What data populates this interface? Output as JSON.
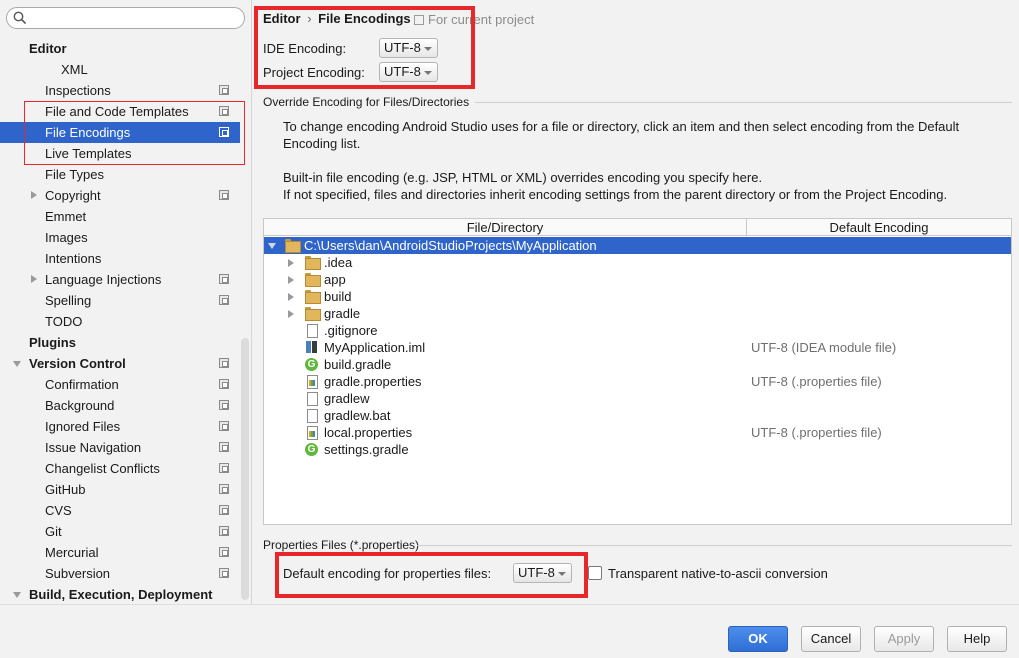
{
  "search": {
    "placeholder": ""
  },
  "sidebar": {
    "items": [
      {
        "label": "Editor",
        "bold": true,
        "indent": "l1"
      },
      {
        "label": "XML",
        "indent": "l3"
      },
      {
        "label": "Inspections",
        "indent": "l2",
        "project": true
      },
      {
        "label": "File and Code Templates",
        "indent": "l2",
        "project": true
      },
      {
        "label": "File Encodings",
        "indent": "l2",
        "project": true,
        "selected": true
      },
      {
        "label": "Live Templates",
        "indent": "l2"
      },
      {
        "label": "File Types",
        "indent": "l2"
      },
      {
        "label": "Copyright",
        "indent": "l2",
        "project": true,
        "expandable": true
      },
      {
        "label": "Emmet",
        "indent": "l2"
      },
      {
        "label": "Images",
        "indent": "l2"
      },
      {
        "label": "Intentions",
        "indent": "l2"
      },
      {
        "label": "Language Injections",
        "indent": "l2",
        "project": true,
        "expandable": true
      },
      {
        "label": "Spelling",
        "indent": "l2",
        "project": true
      },
      {
        "label": "TODO",
        "indent": "l2"
      },
      {
        "label": "Plugins",
        "bold": true,
        "indent": "l1"
      },
      {
        "label": "Version Control",
        "bold": true,
        "indent": "l1",
        "expanded": true,
        "project": true
      },
      {
        "label": "Confirmation",
        "indent": "l2",
        "project": true
      },
      {
        "label": "Background",
        "indent": "l2",
        "project": true
      },
      {
        "label": "Ignored Files",
        "indent": "l2",
        "project": true
      },
      {
        "label": "Issue Navigation",
        "indent": "l2",
        "project": true
      },
      {
        "label": "Changelist Conflicts",
        "indent": "l2",
        "project": true
      },
      {
        "label": "GitHub",
        "indent": "l2",
        "project": true
      },
      {
        "label": "CVS",
        "indent": "l2",
        "project": true
      },
      {
        "label": "Git",
        "indent": "l2",
        "project": true
      },
      {
        "label": "Mercurial",
        "indent": "l2",
        "project": true
      },
      {
        "label": "Subversion",
        "indent": "l2",
        "project": true
      },
      {
        "label": "Build, Execution, Deployment",
        "bold": true,
        "indent": "l1",
        "expanded": true
      }
    ]
  },
  "header": {
    "breadcrumb_parent": "Editor",
    "breadcrumb_sep": "›",
    "breadcrumb_current": "File Encodings",
    "scope_note": "For current project"
  },
  "encoding": {
    "ide_label": "IDE Encoding:",
    "ide_value": "UTF-8",
    "project_label": "Project Encoding:",
    "project_value": "UTF-8"
  },
  "override": {
    "title": "Override Encoding for Files/Directories",
    "desc_line1": "To change encoding Android Studio uses for a file or directory, click an item and then select encoding from the Default",
    "desc_line2": "Encoding list.",
    "desc_line3": "Built-in file encoding (e.g. JSP, HTML or XML) overrides encoding you specify here.",
    "desc_line4": "If not specified, files and directories inherit encoding settings from the parent directory or from the Project Encoding."
  },
  "table": {
    "columns": [
      "File/Directory",
      "Default Encoding"
    ],
    "rows": [
      {
        "name": "C:\\Users\\dan\\AndroidStudioProjects\\MyApplication",
        "icon": "folder-icon",
        "level": 0,
        "arrow": "down",
        "selected": true,
        "encoding": ""
      },
      {
        "name": ".idea",
        "icon": "folder-icon",
        "level": 1,
        "arrow": "right",
        "encoding": ""
      },
      {
        "name": "app",
        "icon": "folder-icon",
        "level": 1,
        "arrow": "right",
        "encoding": ""
      },
      {
        "name": "build",
        "icon": "folder-icon",
        "level": 1,
        "arrow": "right",
        "encoding": ""
      },
      {
        "name": "gradle",
        "icon": "folder-icon",
        "level": 1,
        "arrow": "right",
        "encoding": ""
      },
      {
        "name": ".gitignore",
        "icon": "text-file-icon",
        "level": 1,
        "encoding": ""
      },
      {
        "name": "MyApplication.iml",
        "icon": "module-file-icon",
        "level": 1,
        "encoding": "UTF-8 (IDEA module file)"
      },
      {
        "name": "build.gradle",
        "icon": "gradle-icon",
        "level": 1,
        "encoding": ""
      },
      {
        "name": "gradle.properties",
        "icon": "properties-file-icon",
        "level": 1,
        "encoding": "UTF-8 (.properties file)"
      },
      {
        "name": "gradlew",
        "icon": "text-file-icon",
        "level": 1,
        "encoding": ""
      },
      {
        "name": "gradlew.bat",
        "icon": "text-file-icon",
        "level": 1,
        "encoding": ""
      },
      {
        "name": "local.properties",
        "icon": "properties-file-icon",
        "level": 1,
        "encoding": "UTF-8 (.properties file)"
      },
      {
        "name": "settings.gradle",
        "icon": "gradle-icon",
        "level": 1,
        "encoding": ""
      }
    ]
  },
  "properties": {
    "title": "Properties Files (*.properties)",
    "default_label": "Default encoding for properties files:",
    "default_value": "UTF-8",
    "transparent_label": "Transparent native-to-ascii conversion",
    "transparent_checked": false
  },
  "footer": {
    "ok": "OK",
    "cancel": "Cancel",
    "apply": "Apply",
    "help": "Help"
  },
  "colors": {
    "selection": "#2f65ca",
    "highlight_box": "#e8272b",
    "ok_button": "#2f6fd6"
  }
}
